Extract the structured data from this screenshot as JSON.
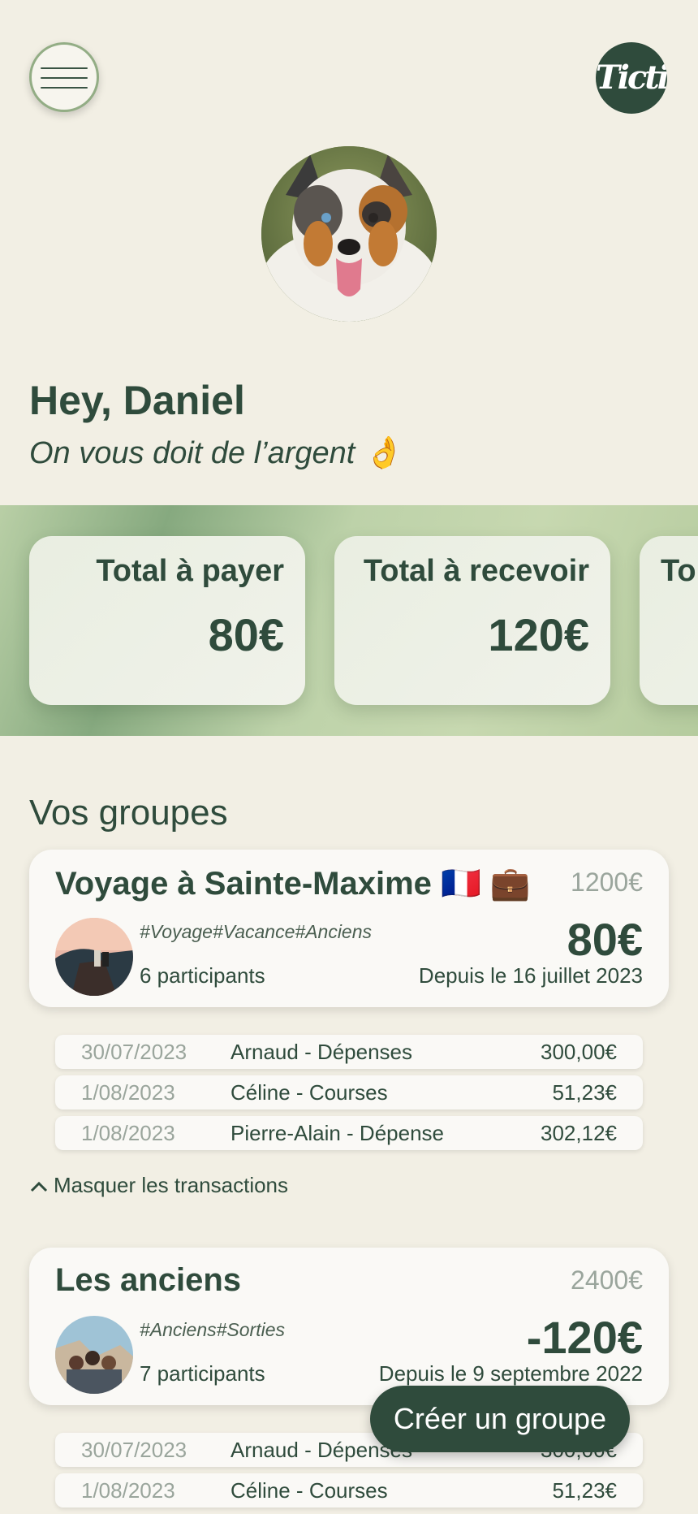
{
  "header": {
    "menu_icon": "hamburger-icon",
    "logo_text": "Tictic"
  },
  "profile": {
    "greeting": "Hey, Daniel",
    "subtitle": "On vous doit de l’argent 👌"
  },
  "stats": [
    {
      "label": "Total à payer",
      "value": "80€"
    },
    {
      "label": "Total à recevoir",
      "value": "120€"
    },
    {
      "label": "To",
      "value": ""
    }
  ],
  "groups_title": "Vos groupes",
  "groups": [
    {
      "name": "Voyage à Sainte-Maxime 🇫🇷 💼",
      "total": "1200€",
      "tags": "#Voyage#Vacance#Anciens",
      "participants": "6 participants",
      "amount": "80€",
      "since": "Depuis le 16 juillet 2023",
      "transactions": [
        {
          "date": "30/07/2023",
          "desc": "Arnaud - Dépenses",
          "amount": "300,00€"
        },
        {
          "date": "1/08/2023",
          "desc": "Céline - Courses",
          "amount": "51,23€"
        },
        {
          "date": "1/08/2023",
          "desc": "Pierre-Alain - Dépense",
          "amount": "302,12€"
        }
      ],
      "toggle_label": "Masquer les transactions"
    },
    {
      "name": "Les anciens",
      "total": "2400€",
      "tags": "#Anciens#Sorties",
      "participants": "7 participants",
      "amount": "-120€",
      "since": "Depuis le 9 septembre 2022",
      "transactions": [
        {
          "date": "30/07/2023",
          "desc": "Arnaud - Dépenses",
          "amount": "300,00€"
        },
        {
          "date": "1/08/2023",
          "desc": "Céline - Courses",
          "amount": "51,23€"
        }
      ]
    }
  ],
  "create_group_label": "Créer un groupe",
  "colors": {
    "primary": "#2f4b3c",
    "background": "#f2efe4",
    "muted": "#9aa59c",
    "accent": "#93ad85"
  }
}
